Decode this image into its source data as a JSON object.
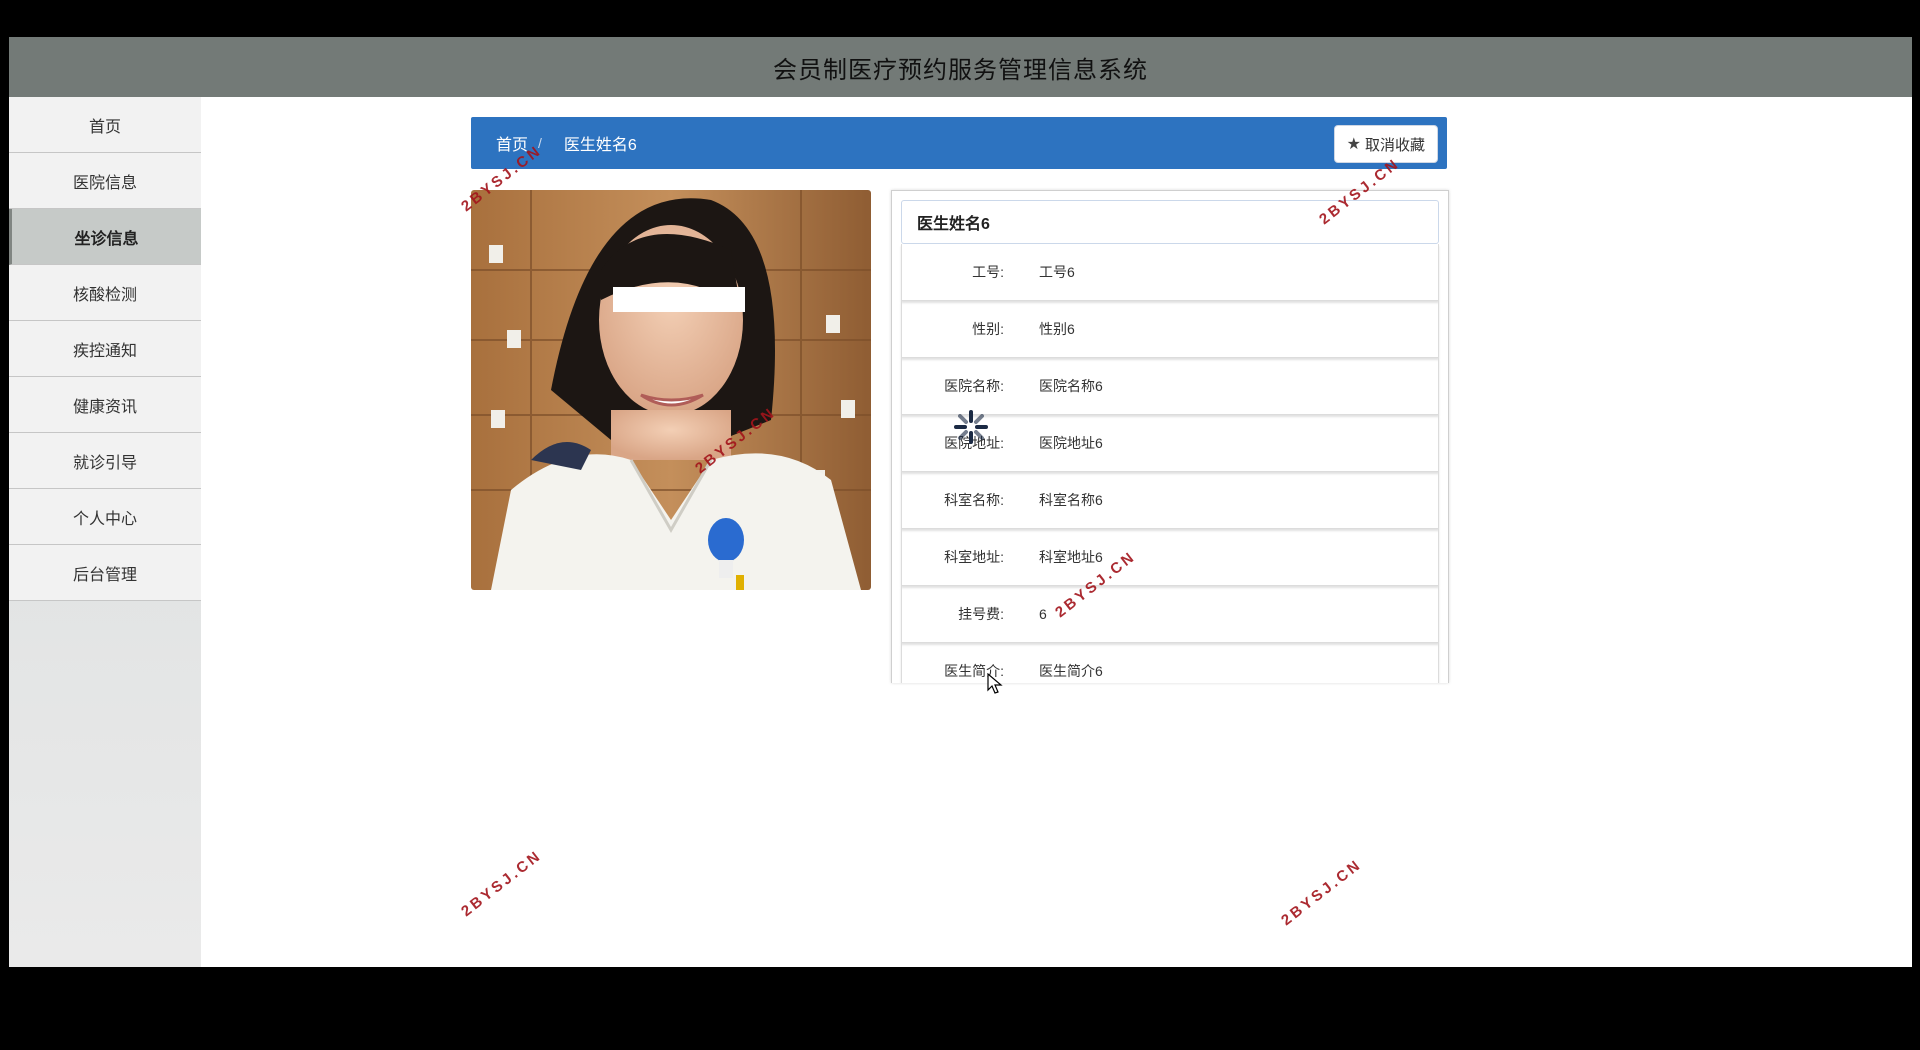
{
  "app": {
    "title": "会员制医疗预约服务管理信息系统"
  },
  "sidebar": {
    "items": [
      {
        "label": "首页"
      },
      {
        "label": "医院信息"
      },
      {
        "label": "坐诊信息",
        "active": true
      },
      {
        "label": "核酸检测"
      },
      {
        "label": "疾控通知"
      },
      {
        "label": "健康资讯"
      },
      {
        "label": "就诊引导"
      },
      {
        "label": "个人中心"
      },
      {
        "label": "后台管理"
      }
    ]
  },
  "breadcrumb": {
    "home": "首页",
    "separator": "/",
    "current": "医生姓名6"
  },
  "favorite_button": {
    "label": "取消收藏",
    "icon": "star-icon"
  },
  "doctor": {
    "name": "医生姓名6",
    "fields": [
      {
        "label": "工号:",
        "value": "工号6"
      },
      {
        "label": "性别:",
        "value": "性别6"
      },
      {
        "label": "医院名称:",
        "value": "医院名称6"
      },
      {
        "label": "医院地址:",
        "value": "医院地址6"
      },
      {
        "label": "科室名称:",
        "value": "科室名称6"
      },
      {
        "label": "科室地址:",
        "value": "科室地址6"
      },
      {
        "label": "挂号费:",
        "value": "6"
      },
      {
        "label": "医生简介:",
        "value": "医生简介6"
      }
    ]
  },
  "watermark": "2BYSJ.CN",
  "colors": {
    "topbar": "#737a77",
    "crumbbar": "#2d73c0",
    "watermark": "#a3141b"
  }
}
